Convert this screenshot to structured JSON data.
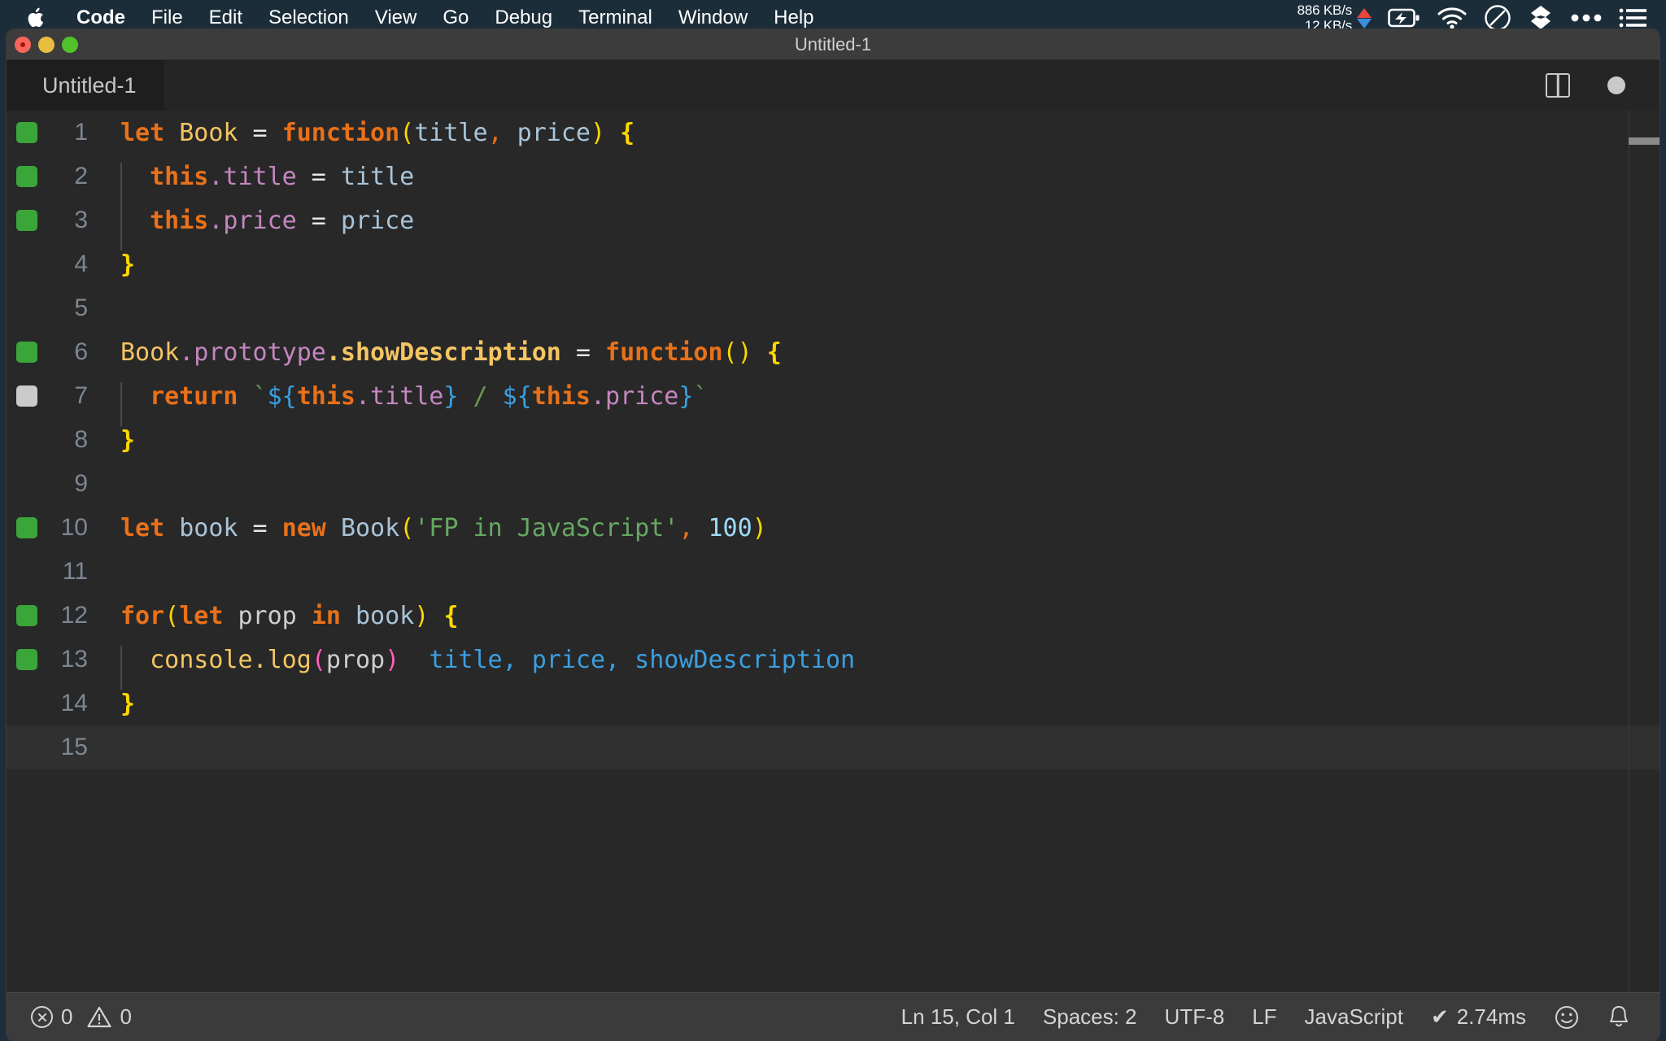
{
  "menubar": {
    "apple_icon": "apple-logo-icon",
    "items": [
      {
        "label": "Code",
        "bold": true
      },
      {
        "label": "File",
        "bold": false
      },
      {
        "label": "Edit",
        "bold": false
      },
      {
        "label": "Selection",
        "bold": false
      },
      {
        "label": "View",
        "bold": false
      },
      {
        "label": "Go",
        "bold": false
      },
      {
        "label": "Debug",
        "bold": false
      },
      {
        "label": "Terminal",
        "bold": false
      },
      {
        "label": "Window",
        "bold": false
      },
      {
        "label": "Help",
        "bold": false
      }
    ],
    "network": {
      "upload": "886 KB/s",
      "download": "12 KB/s",
      "upload_arrow_color": "#e8453c",
      "download_arrow_color": "#3b8fdd"
    },
    "status_icons": [
      "battery-charging-icon",
      "wifi-icon",
      "do-not-disturb-icon",
      "dropbox-icon",
      "ellipsis-icon",
      "list-menu-icon"
    ]
  },
  "window": {
    "title": "Untitled-1",
    "traffic_lights": [
      "close-button",
      "minimize-button",
      "maximize-button"
    ]
  },
  "tabbar": {
    "tab_label": "Untitled-1",
    "split_editor_icon": "split-editor-icon",
    "unsaved_indicator": "unsaved-dot-icon"
  },
  "editor": {
    "language": "JavaScript",
    "lines": [
      {
        "n": "1",
        "mark": "green",
        "indent": 0
      },
      {
        "n": "2",
        "mark": "green",
        "indent": 1
      },
      {
        "n": "3",
        "mark": "green",
        "indent": 1
      },
      {
        "n": "4",
        "mark": "none",
        "indent": 0
      },
      {
        "n": "5",
        "mark": "none",
        "indent": 0
      },
      {
        "n": "6",
        "mark": "green",
        "indent": 0
      },
      {
        "n": "7",
        "mark": "grey",
        "indent": 1
      },
      {
        "n": "8",
        "mark": "none",
        "indent": 0
      },
      {
        "n": "9",
        "mark": "none",
        "indent": 0
      },
      {
        "n": "10",
        "mark": "green",
        "indent": 0
      },
      {
        "n": "11",
        "mark": "none",
        "indent": 0
      },
      {
        "n": "12",
        "mark": "green",
        "indent": 0
      },
      {
        "n": "13",
        "mark": "green",
        "indent": 1
      },
      {
        "n": "14",
        "mark": "none",
        "indent": 0
      },
      {
        "n": "15",
        "mark": "none",
        "indent": 0
      }
    ],
    "source_text": [
      "let Book = function(title, price) {",
      "  this.title = title",
      "  this.price = price",
      "}",
      "",
      "Book.prototype.showDescription = function() {",
      "  return `${this.title} / ${this.price}`",
      "}",
      "",
      "let book = new Book('FP in JavaScript', 100)",
      "",
      "for(let prop in book) {",
      "  console.log(prop)  title, price, showDescription",
      "}",
      ""
    ],
    "inline_hint": "title, price, showDescription",
    "active_line": "15",
    "colors": {
      "background": "#282828",
      "keyword": "#e8711a",
      "function": "#f5c563",
      "variable": "#a9c4d8",
      "property": "#c586c0",
      "string": "#6a9955",
      "number": "#9cdcfe",
      "paren_yellow": "#ffd700",
      "paren_magenta": "#ff5ebc",
      "interpolation": "#3b9fe0",
      "hint": "#3b9fe0",
      "breakpoint_green": "#3aa63a",
      "breakpoint_grey": "#cbcbcb"
    }
  },
  "statusbar": {
    "errors": "0",
    "warnings": "0",
    "cursor": "Ln 15, Col 1",
    "spaces": "Spaces: 2",
    "encoding": "UTF-8",
    "eol": "LF",
    "language": "JavaScript",
    "timing": "2.74ms",
    "timing_check": "✔",
    "feedback_icon": "smiley-icon",
    "notifications_icon": "bell-icon"
  }
}
